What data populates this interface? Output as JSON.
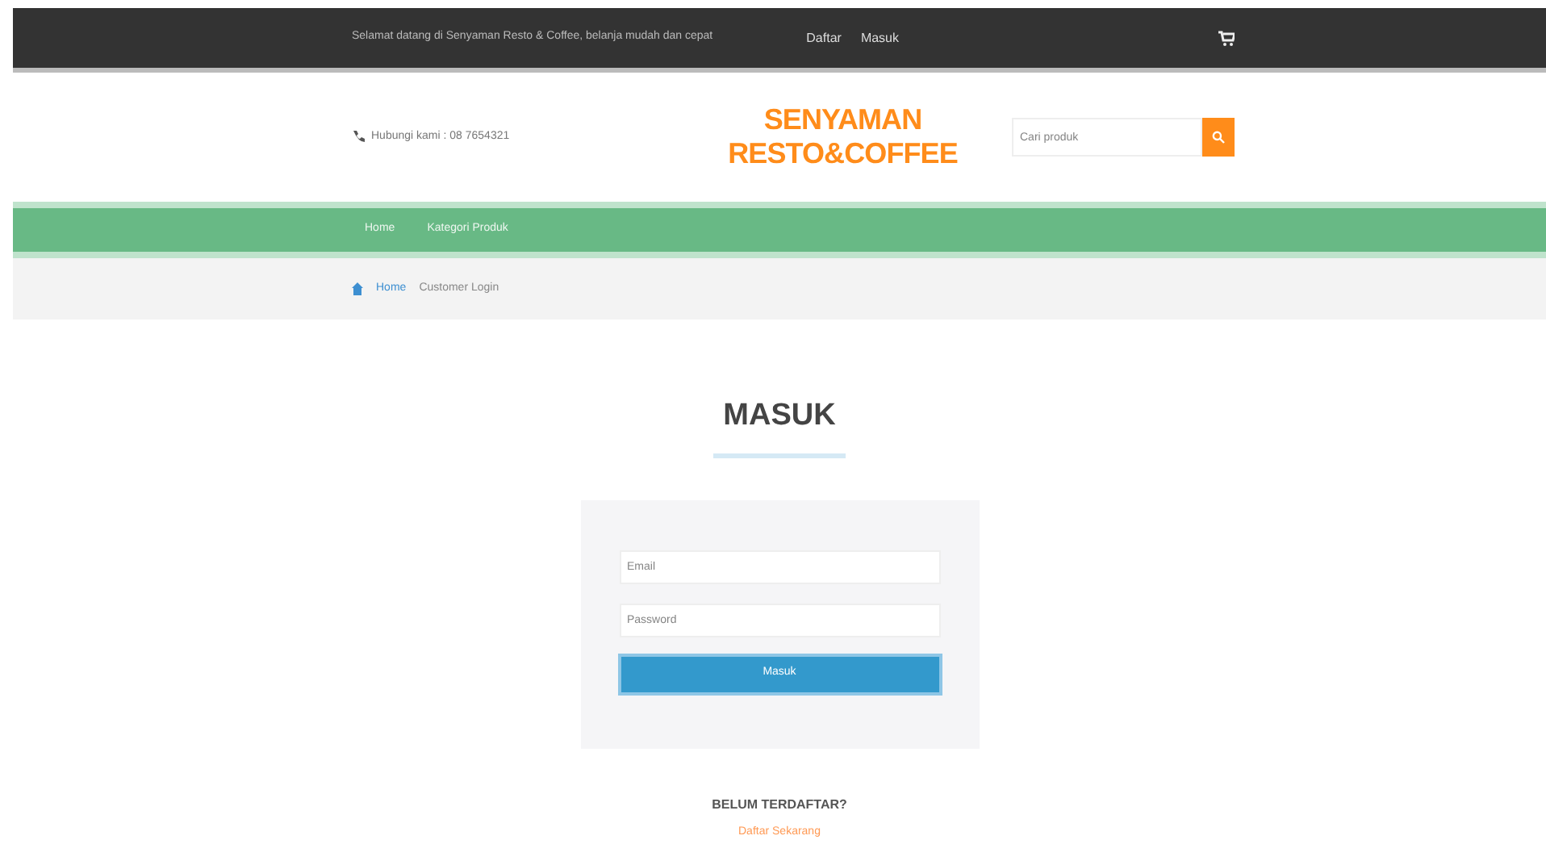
{
  "top_bar": {
    "announcement": "Selamat datang di Senyaman Resto & Coffee, belanja mudah dan cepat",
    "links": [
      {
        "label": "Daftar"
      },
      {
        "label": "Masuk"
      }
    ]
  },
  "header": {
    "phone": "Hubungi kami : 08 7654321",
    "logo_lines": [
      "SENYAMAN",
      "RESTO&COFFEE"
    ],
    "search": {
      "placeholder": "Cari produk"
    }
  },
  "nav": [
    {
      "label": "Home"
    },
    {
      "label": "Kategori Produk"
    }
  ],
  "breadcrumb": [
    {
      "label": "Home",
      "kind": "link"
    },
    {
      "label": "Customer Login",
      "kind": "current"
    }
  ],
  "login": {
    "title": "MASUK",
    "fields": [
      {
        "placeholder": "Email"
      },
      {
        "placeholder": "Password"
      }
    ],
    "button": "Masuk"
  },
  "register": {
    "heading": "BELUM TERDAFTAR?",
    "link": "Daftar Sekarang"
  }
}
